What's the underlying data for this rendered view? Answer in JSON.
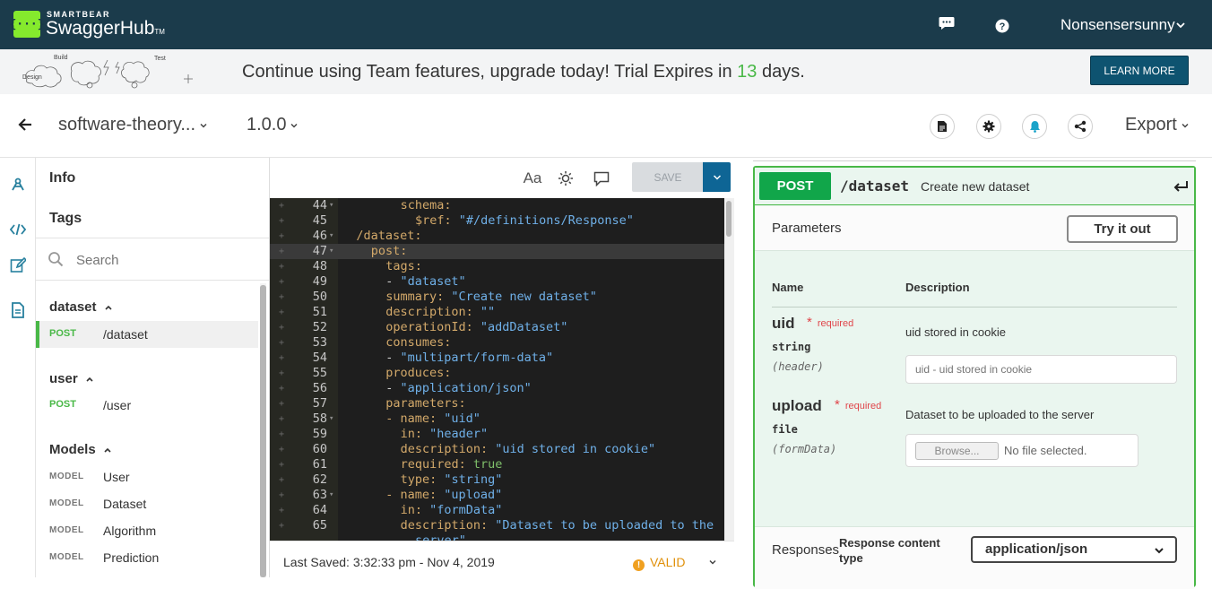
{
  "header": {
    "brand_small": "SMARTBEAR",
    "brand_big": "SwaggerHub",
    "brand_tm": "TM",
    "logo_glyph": "{···}",
    "icons": [
      "chat-icon",
      "help-icon"
    ],
    "user_name": "Nonsensersunny"
  },
  "banner": {
    "art_labels": [
      "Build",
      "Test",
      "Design"
    ],
    "text_before": "Continue using Team features, upgrade today! Trial Expires in ",
    "days": "13",
    "text_after": " days.",
    "button": "LEARN MORE",
    "days_color": "#49b847"
  },
  "titlerow": {
    "api_name": "software-theory...",
    "version": "1.0.0",
    "action_icons": [
      "document-icon",
      "settings-icon",
      "notification-icon",
      "share-icon"
    ],
    "export_label": "Export"
  },
  "rail": {
    "icons": [
      "design-icon",
      "code-icon",
      "edit-icon",
      "docs-icon"
    ]
  },
  "nav": {
    "info": "Info",
    "tags": "Tags",
    "search_placeholder": "Search",
    "groups": [
      {
        "label": "dataset",
        "items": [
          {
            "verb": "POST",
            "path": "/dataset",
            "active": true
          }
        ]
      },
      {
        "label": "user",
        "items": [
          {
            "verb": "POST",
            "path": "/user",
            "active": false
          }
        ]
      },
      {
        "label": "Models",
        "items": [
          {
            "tag": "MODEL",
            "name": "User"
          },
          {
            "tag": "MODEL",
            "name": "Dataset"
          },
          {
            "tag": "MODEL",
            "name": "Algorithm"
          },
          {
            "tag": "MODEL",
            "name": "Prediction"
          }
        ]
      }
    ]
  },
  "editor": {
    "font_button": "Aa",
    "save_label": "SAVE",
    "lines": [
      {
        "n": "44",
        "fold": true,
        "hl": false,
        "indent": 8,
        "k": "schema:",
        "v": ""
      },
      {
        "n": "45",
        "fold": false,
        "hl": false,
        "indent": 10,
        "k": "$ref:",
        "v": " \"#/definitions/Response\""
      },
      {
        "n": "46",
        "fold": true,
        "hl": false,
        "indent": 2,
        "k": "/dataset:",
        "v": ""
      },
      {
        "n": "47",
        "fold": true,
        "hl": true,
        "indent": 4,
        "k": "post:",
        "v": ""
      },
      {
        "n": "48",
        "fold": false,
        "hl": false,
        "indent": 6,
        "k": "tags:",
        "v": ""
      },
      {
        "n": "49",
        "fold": false,
        "hl": false,
        "indent": 6,
        "k": "- ",
        "v": "\"dataset\""
      },
      {
        "n": "50",
        "fold": false,
        "hl": false,
        "indent": 6,
        "k": "summary:",
        "v": " \"Create new dataset\""
      },
      {
        "n": "51",
        "fold": false,
        "hl": false,
        "indent": 6,
        "k": "description:",
        "v": " \"\""
      },
      {
        "n": "52",
        "fold": false,
        "hl": false,
        "indent": 6,
        "k": "operationId:",
        "v": " \"addDataset\""
      },
      {
        "n": "53",
        "fold": false,
        "hl": false,
        "indent": 6,
        "k": "consumes:",
        "v": ""
      },
      {
        "n": "54",
        "fold": false,
        "hl": false,
        "indent": 6,
        "k": "- ",
        "v": "\"multipart/form-data\""
      },
      {
        "n": "55",
        "fold": false,
        "hl": false,
        "indent": 6,
        "k": "produces:",
        "v": ""
      },
      {
        "n": "56",
        "fold": false,
        "hl": false,
        "indent": 6,
        "k": "- ",
        "v": "\"application/json\""
      },
      {
        "n": "57",
        "fold": false,
        "hl": false,
        "indent": 6,
        "k": "parameters:",
        "v": ""
      },
      {
        "n": "58",
        "fold": true,
        "hl": false,
        "indent": 6,
        "k": "- name:",
        "v": " \"uid\""
      },
      {
        "n": "59",
        "fold": false,
        "hl": false,
        "indent": 8,
        "k": "in:",
        "v": " \"header\""
      },
      {
        "n": "60",
        "fold": false,
        "hl": false,
        "indent": 8,
        "k": "description:",
        "v": " \"uid stored in cookie\""
      },
      {
        "n": "61",
        "fold": false,
        "hl": false,
        "indent": 8,
        "k": "required:",
        "b": " true"
      },
      {
        "n": "62",
        "fold": false,
        "hl": false,
        "indent": 8,
        "k": "type:",
        "v": " \"string\""
      },
      {
        "n": "63",
        "fold": true,
        "hl": false,
        "indent": 6,
        "k": "- name:",
        "v": " \"upload\""
      },
      {
        "n": "64",
        "fold": false,
        "hl": false,
        "indent": 8,
        "k": "in:",
        "v": " \"formData\""
      },
      {
        "n": "65",
        "fold": false,
        "hl": false,
        "indent": 8,
        "k": "description:",
        "v": " \"Dataset to be uploaded to the"
      },
      {
        "n": "",
        "fold": false,
        "hl": false,
        "indent": 10,
        "k": "",
        "v": "server\""
      }
    ]
  },
  "status": {
    "last_saved": "Last Saved:  3:32:33 pm  -  Nov 4, 2019",
    "valid": "VALID",
    "valid_icon": "!"
  },
  "docs": {
    "method": "POST",
    "path": "/dataset",
    "summary": "Create new dataset",
    "parameters_label": "Parameters",
    "try_button": "Try it out",
    "col_name": "Name",
    "col_desc": "Description",
    "required_label": "required",
    "required_star": "*",
    "params": [
      {
        "name": "uid",
        "type": "string",
        "in": "(header)",
        "desc": "uid stored in cookie",
        "placeholder": "uid - uid stored in cookie"
      },
      {
        "name": "upload",
        "type": "file",
        "in": "(formData)",
        "desc": "Dataset to be uploaded to the server",
        "browse": "Browse...",
        "nofile": "No file selected."
      }
    ],
    "responses_label": "Responses",
    "response_ct_label": "Response content type",
    "response_ct_value": "application/json"
  }
}
